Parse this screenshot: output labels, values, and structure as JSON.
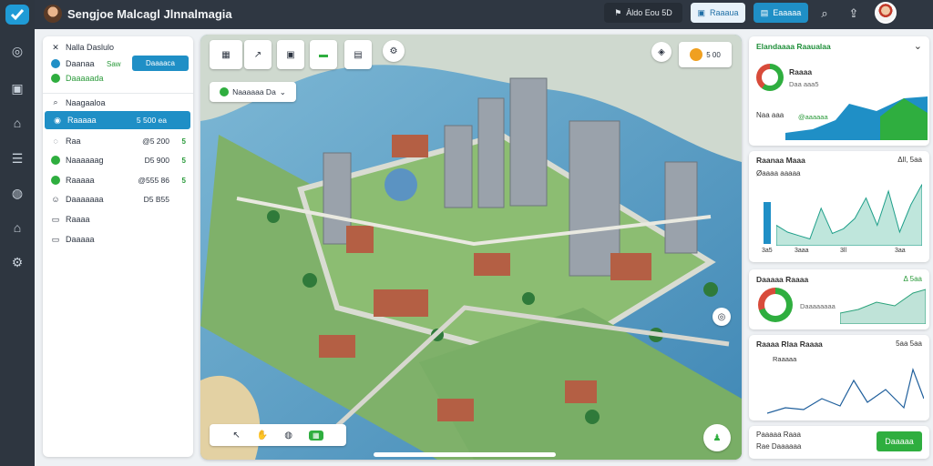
{
  "header": {
    "title": "Sengjoe Malcagl Jlnnalmagia",
    "status_text": "Àldo Eou 5D",
    "btn1": "Raaaua",
    "btn2": "Eaaaaa"
  },
  "left": {
    "heading1": "Nalla Daslulo",
    "row_a_label": "Daanaa",
    "row_a_tag": "Saw",
    "row_a_btn": "Daaaaca",
    "row_b_label": "Daaaaada",
    "search": "Naagaaloa",
    "items": [
      {
        "label": "Raaaaa",
        "value": "5 500 ea",
        "tag": ""
      },
      {
        "label": "Raa",
        "value": "@5 200",
        "tag": "5"
      },
      {
        "label": "Naaaaaag",
        "value": "D5 900",
        "tag": "5"
      },
      {
        "label": "Raaaaa",
        "value": "@555 86",
        "tag": "5"
      },
      {
        "label": "Daaaaaaa",
        "value": "D5 B55",
        "tag": ""
      },
      {
        "label": "Raaaa",
        "value": "",
        "tag": ""
      },
      {
        "label": "Daaaaa",
        "value": "",
        "tag": ""
      }
    ]
  },
  "map": {
    "location": "Naaaaaa Da",
    "zoom_label": "5 00"
  },
  "right": {
    "panel1": {
      "title": "Elandaaaa Raaualaa",
      "donut_label": "Raaaa",
      "donut_sub": "Daa aaa5",
      "foot_label": "Naa aaa",
      "foot_value": "@aaaaaa"
    },
    "panel2": {
      "title": "Raanaa Maaa",
      "sub": "Øaaaa aaaaa",
      "range": "Δll, 5aa",
      "x_ticks": [
        "3a5",
        "3aaa",
        "3ll",
        "3aa"
      ],
      "values": [
        30,
        20,
        15,
        10,
        55,
        18,
        25,
        40,
        70,
        30,
        80,
        20,
        60,
        90
      ]
    },
    "panel3": {
      "title": "Daaaaa Raaaa",
      "value": "Δ 5aa",
      "donut_sub": "Daaaaaaaa"
    },
    "panel4": {
      "title": "Raaaa Rlaa Raaaa",
      "sub": "Raaaaa",
      "value": "5aa 5aa"
    },
    "panel5": {
      "label1": "Paaaaa Raaa",
      "label2": "Rae Daaaaaa",
      "button": "Daaaaa"
    }
  },
  "colors": {
    "accent": "#1f8fc6",
    "green": "#2fae3f",
    "rail": "#2e3640"
  }
}
